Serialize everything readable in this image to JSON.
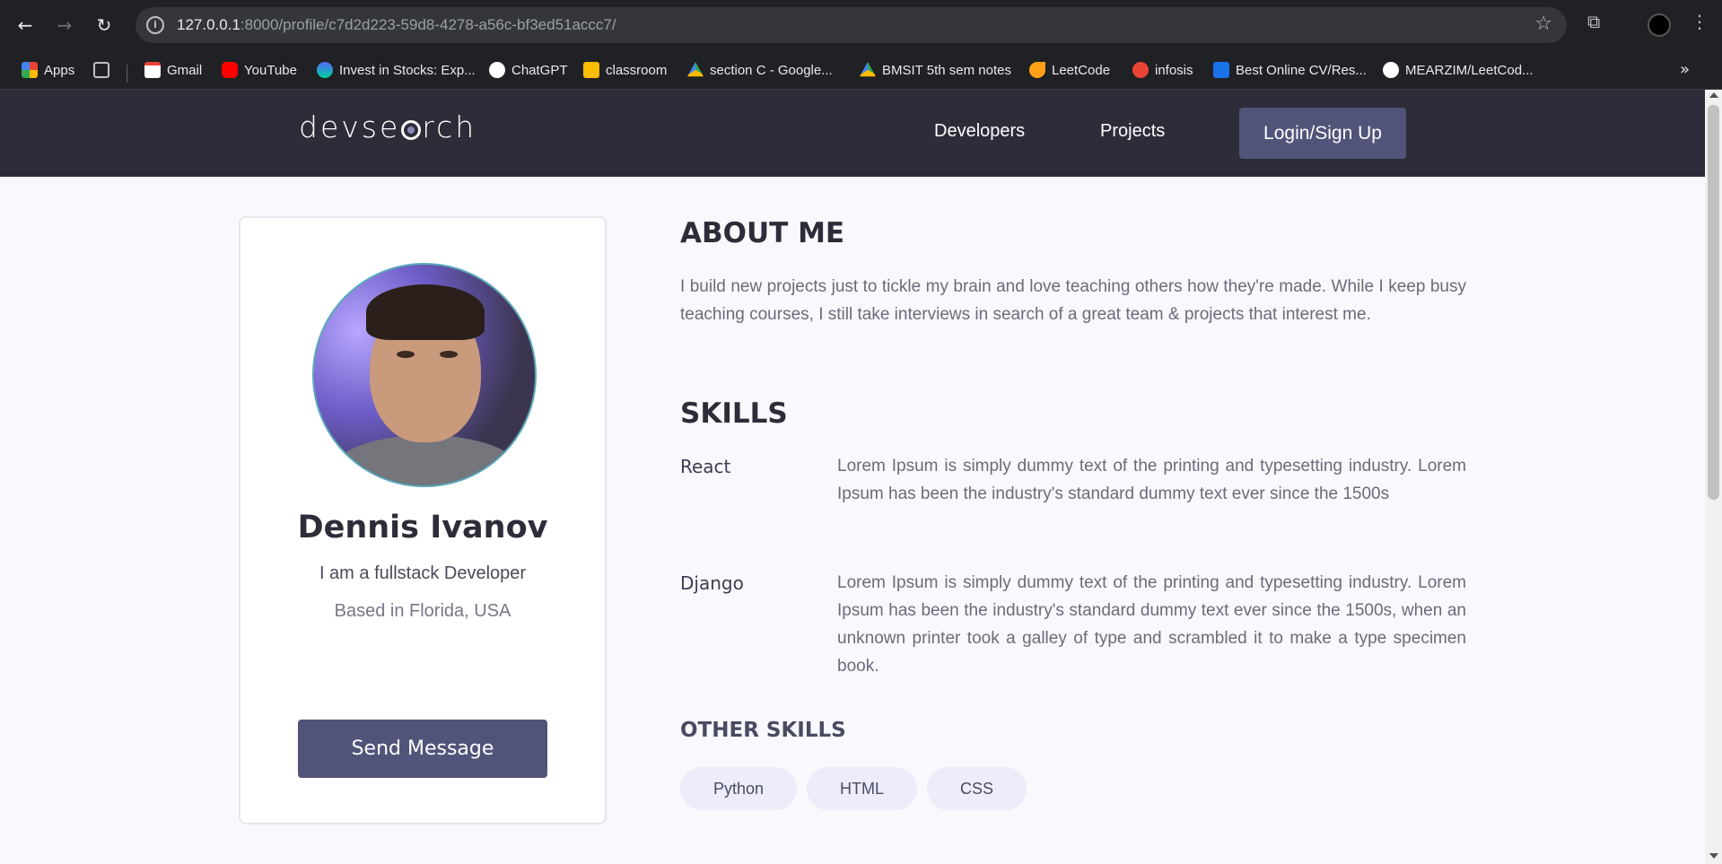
{
  "browser": {
    "url_host": "127.0.0.1",
    "url_rest": ":8000/profile/c7d2d223-59d8-4278-a56c-bf3ed51accc7/",
    "bookmarks": [
      {
        "label": "Apps",
        "color": "#ea4335"
      },
      {
        "label": "",
        "color": "#5f6368"
      },
      {
        "label": "Gmail",
        "color": "#ea4335"
      },
      {
        "label": "YouTube",
        "color": "#ff0000"
      },
      {
        "label": "Invest in Stocks: Exp...",
        "color": "#00b386"
      },
      {
        "label": "ChatGPT",
        "color": "#ffffff"
      },
      {
        "label": "classroom",
        "color": "#fbbc04"
      },
      {
        "label": "section C - Google...",
        "color": "#34a853"
      },
      {
        "label": "BMSIT 5th sem notes",
        "color": "#4285f4"
      },
      {
        "label": "LeetCode",
        "color": "#ffa116"
      },
      {
        "label": "infosis",
        "color": "#ea4335"
      },
      {
        "label": "Best Online CV/Res...",
        "color": "#1a73e8"
      },
      {
        "label": "MEARZIM/LeetCod...",
        "color": "#ffffff"
      }
    ]
  },
  "nav": {
    "logo": "devsearch",
    "links": [
      "Developers",
      "Projects"
    ],
    "login": "Login/Sign Up"
  },
  "profile": {
    "name": "Dennis Ivanov",
    "tagline": "I am a fullstack Developer",
    "location": "Based in Florida, USA",
    "message_button": "Send Message"
  },
  "about": {
    "heading": "ABOUT ME",
    "text": "I build new projects just to tickle my brain and love teaching others how they're made. While I keep busy teaching courses, I still take interviews in search of a great team & projects that interest me."
  },
  "skills": {
    "heading": "SKILLS",
    "items": [
      {
        "name": "React",
        "desc": "Lorem Ipsum is simply dummy text of the printing and typesetting industry. Lorem Ipsum has been the industry's standard dummy text ever since the 1500s"
      },
      {
        "name": "Django",
        "desc": "Lorem Ipsum is simply dummy text of the printing and typesetting industry. Lorem Ipsum has been the industry's standard dummy text ever since the 1500s, when an unknown printer took a galley of type and scrambled it to make a type specimen book."
      }
    ]
  },
  "other_skills": {
    "heading": "OTHER SKILLS",
    "tags": [
      "Python",
      "HTML",
      "CSS"
    ]
  }
}
